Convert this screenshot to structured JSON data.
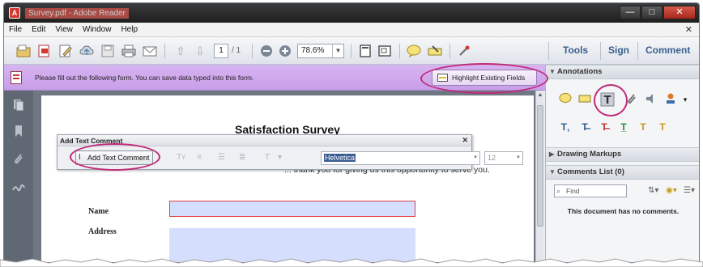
{
  "window": {
    "title": "Survey.pdf - Adobe Reader",
    "controls": [
      "—",
      "□",
      "✕"
    ]
  },
  "menu": {
    "items": [
      "File",
      "Edit",
      "View",
      "Window",
      "Help"
    ],
    "close_glyph": "✕"
  },
  "toolbar": {
    "page_current": "1",
    "page_total": "/ 1",
    "zoom": "78.6%",
    "tabs": [
      "Tools",
      "Sign",
      "Comment"
    ]
  },
  "form_bar": {
    "message": "Please fill out the following form. You can save data typed into this form.",
    "highlight_button": "Highlight Existing Fields"
  },
  "document": {
    "title": "Satisfaction Survey",
    "intro_visible": "... thank you for giving us this opportunity to serve you.",
    "fields": [
      {
        "label": "Name"
      },
      {
        "label": "Address"
      }
    ]
  },
  "add_text_comment": {
    "header": "Add Text Comment",
    "close_glyph": "✕",
    "button": "Add Text Comment",
    "font": "Helvetica",
    "size": "12"
  },
  "right_panel": {
    "annotations_header": "Annotations",
    "drawing_header": "Drawing Markups",
    "comments_header": "Comments List (0)",
    "search_placeholder": "Find",
    "no_comments": "This document has no comments."
  },
  "colors": {
    "form_bar": "#c89ee9",
    "highlight_ellipse": "#c02a7a",
    "field_fill": "#d5defc",
    "field_required_border": "#e04040",
    "accent_text": "#3a5f8f"
  }
}
